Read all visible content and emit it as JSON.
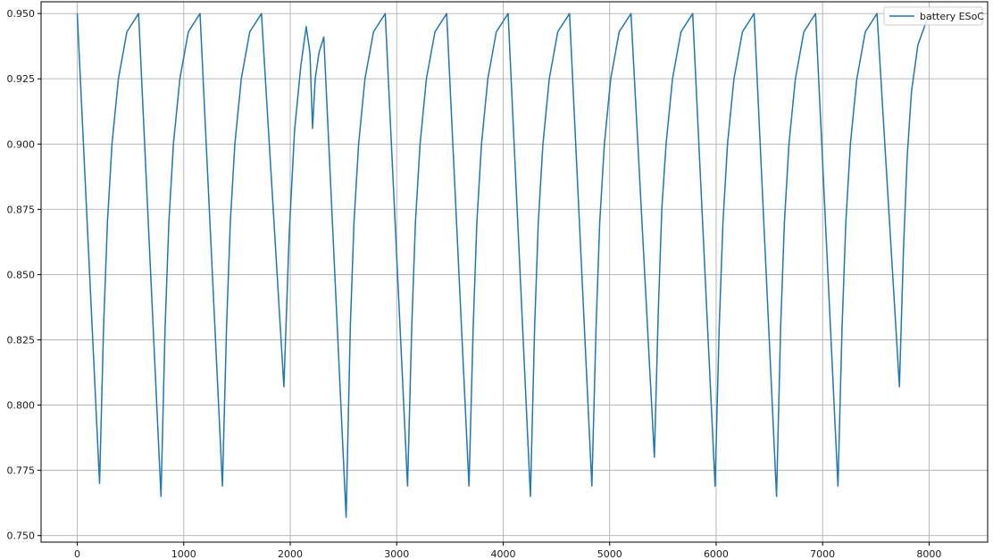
{
  "chart_data": {
    "type": "line",
    "title": "",
    "xlabel": "",
    "ylabel": "",
    "xlim": [
      -340,
      8550
    ],
    "ylim": [
      0.7475,
      0.9545
    ],
    "x_ticks": [
      0,
      1000,
      2000,
      3000,
      4000,
      5000,
      6000,
      7000,
      8000
    ],
    "x_tick_labels": [
      "0",
      "1000",
      "2000",
      "3000",
      "4000",
      "5000",
      "6000",
      "7000",
      "8000"
    ],
    "y_ticks": [
      0.75,
      0.775,
      0.8,
      0.825,
      0.85,
      0.875,
      0.9,
      0.925,
      0.95
    ],
    "y_tick_labels": [
      "0.750",
      "0.775",
      "0.800",
      "0.825",
      "0.850",
      "0.875",
      "0.900",
      "0.925",
      "0.950"
    ],
    "grid": true,
    "legend_position": "top-right",
    "colors": {
      "series": "#1f77b4",
      "grid": "#b0b0b0",
      "axes": "#000000"
    },
    "series": [
      {
        "name": "battery ESoC",
        "x": [
          0,
          209,
          247,
          283,
          326,
          386,
          466,
          576,
          786,
          825,
          860,
          903,
          963,
          1043,
          1153,
          1363,
          1402,
          1437,
          1480,
          1540,
          1620,
          1730,
          1940,
          1990,
          2040,
          2100,
          2150,
          2185,
          2210,
          2235,
          2270,
          2315,
          2525,
          2564,
          2599,
          2642,
          2702,
          2782,
          2892,
          3102,
          3141,
          3176,
          3219,
          3279,
          3359,
          3469,
          3679,
          3718,
          3753,
          3796,
          3856,
          3936,
          4046,
          4256,
          4295,
          4330,
          4373,
          4433,
          4513,
          4623,
          4833,
          4872,
          4907,
          4950,
          5010,
          5090,
          5200,
          5420,
          5456,
          5490,
          5530,
          5590,
          5670,
          5780,
          5990,
          6029,
          6064,
          6107,
          6167,
          6247,
          6357,
          6567,
          6606,
          6641,
          6684,
          6744,
          6824,
          6934,
          7144,
          7183,
          7218,
          7261,
          7321,
          7401,
          7511,
          7721,
          7760,
          7794,
          7835,
          7895,
          7975,
          8085
        ],
        "values": [
          0.95,
          0.77,
          0.83,
          0.87,
          0.9,
          0.925,
          0.943,
          0.95,
          0.765,
          0.83,
          0.87,
          0.9,
          0.925,
          0.943,
          0.95,
          0.769,
          0.83,
          0.87,
          0.9,
          0.925,
          0.943,
          0.95,
          0.807,
          0.865,
          0.905,
          0.93,
          0.945,
          0.935,
          0.906,
          0.925,
          0.935,
          0.941,
          0.757,
          0.83,
          0.87,
          0.9,
          0.925,
          0.943,
          0.95,
          0.769,
          0.83,
          0.87,
          0.9,
          0.925,
          0.943,
          0.95,
          0.769,
          0.83,
          0.87,
          0.9,
          0.925,
          0.943,
          0.95,
          0.765,
          0.83,
          0.87,
          0.9,
          0.925,
          0.943,
          0.95,
          0.769,
          0.83,
          0.87,
          0.9,
          0.925,
          0.943,
          0.95,
          0.78,
          0.835,
          0.875,
          0.9,
          0.925,
          0.943,
          0.95,
          0.769,
          0.83,
          0.87,
          0.9,
          0.925,
          0.943,
          0.95,
          0.765,
          0.83,
          0.87,
          0.9,
          0.925,
          0.943,
          0.95,
          0.769,
          0.83,
          0.87,
          0.9,
          0.925,
          0.943,
          0.95,
          0.807,
          0.86,
          0.895,
          0.92,
          0.938,
          0.947,
          0.95
        ]
      }
    ]
  }
}
